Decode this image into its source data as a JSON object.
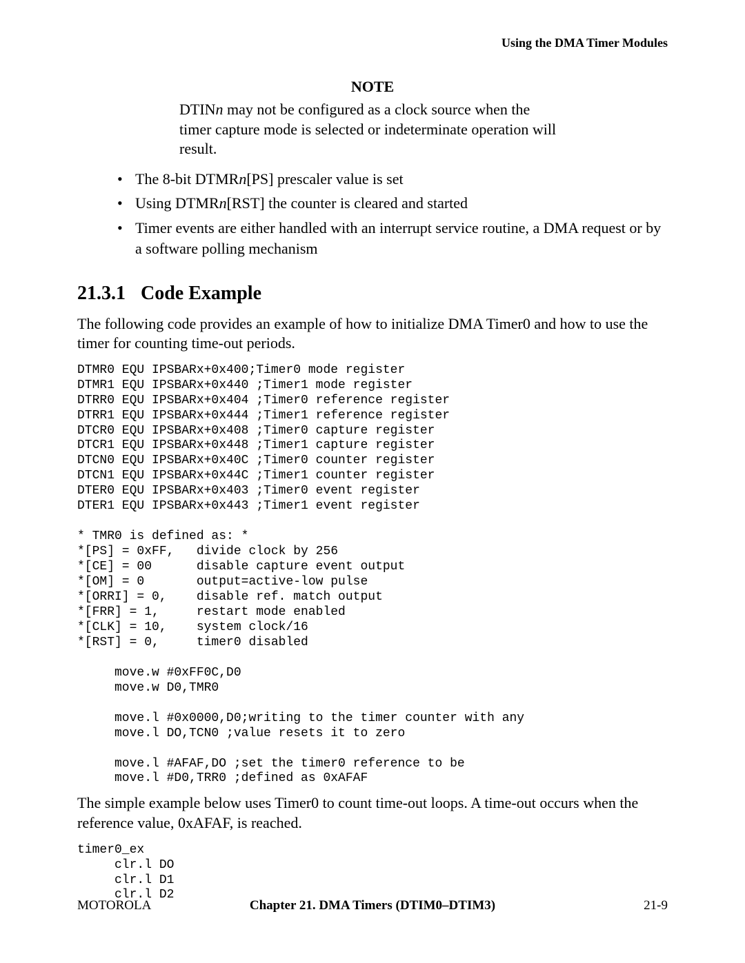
{
  "running_header": "Using the DMA Timer Modules",
  "note": {
    "title": "NOTE",
    "body_pre": "DTIN",
    "body_n": "n",
    "body_post": " may not be configured as a clock source when the timer capture mode is selected or indeterminate operation will result."
  },
  "bullets": {
    "b1_pre": "The 8-bit DTMR",
    "b1_n": "n",
    "b1_post": "[PS] prescaler value is set",
    "b2_pre": "Using DTMR",
    "b2_n": "n",
    "b2_post": "[RST] the counter is cleared and started",
    "b3": "Timer events are either handled with an interrupt service routine, a DMA request or by a software polling mechanism"
  },
  "section": {
    "number": "21.3.1",
    "title": "Code Example"
  },
  "para1": "The following code provides an example of how to initialize DMA Timer0 and how to use the timer for counting time-out periods.",
  "code1": "DTMR0 EQU IPSBARx+0x400;Timer0 mode register\nDTMR1 EQU IPSBARx+0x440 ;Timer1 mode register\nDTRR0 EQU IPSBARx+0x404 ;Timer0 reference register\nDTRR1 EQU IPSBARx+0x444 ;Timer1 reference register\nDTCR0 EQU IPSBARx+0x408 ;Timer0 capture register\nDTCR1 EQU IPSBARx+0x448 ;Timer1 capture register\nDTCN0 EQU IPSBARx+0x40C ;Timer0 counter register\nDTCN1 EQU IPSBARx+0x44C ;Timer1 counter register\nDTER0 EQU IPSBARx+0x403 ;Timer0 event register\nDTER1 EQU IPSBARx+0x443 ;Timer1 event register\n\n* TMR0 is defined as: *\n*[PS] = 0xFF,   divide clock by 256\n*[CE] = 00      disable capture event output\n*[OM] = 0       output=active-low pulse\n*[ORRI] = 0,    disable ref. match output\n*[FRR] = 1,     restart mode enabled\n*[CLK] = 10,    system clock/16\n*[RST] = 0,     timer0 disabled\n\n     move.w #0xFF0C,D0\n     move.w D0,TMR0\n\n     move.l #0x0000,D0;writing to the timer counter with any\n     move.l DO,TCN0 ;value resets it to zero\n\n     move.l #AFAF,DO ;set the timer0 reference to be\n     move.l #D0,TRR0 ;defined as 0xAFAF",
  "para2": "The simple example below uses Timer0 to count time-out loops. A time-out occurs when the reference value, 0xAFAF, is reached.",
  "code2": "timer0_ex\n     clr.l DO\n     clr.l D1\n     clr.l D2",
  "footer": {
    "left": "MOTOROLA",
    "center": "Chapter 21.  DMA Timers (DTIM0–DTIM3)",
    "right": "21-9"
  }
}
